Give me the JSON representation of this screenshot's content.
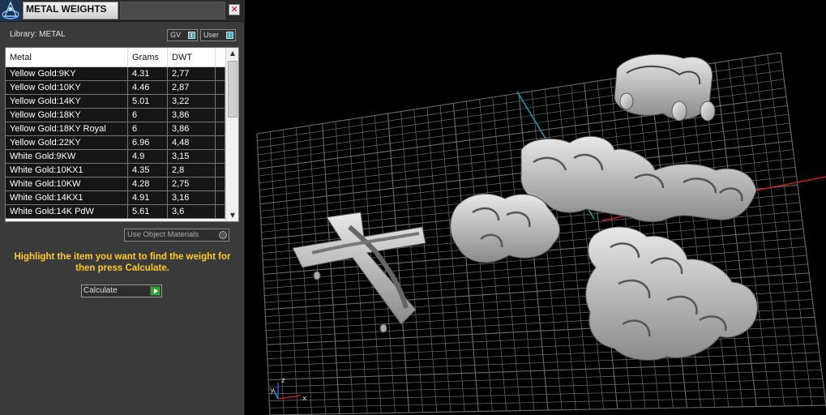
{
  "panel": {
    "title": "METAL WEIGHTS",
    "close_glyph": "✕",
    "library_label": "Library: METAL",
    "library_buttons": [
      {
        "label": "GV"
      },
      {
        "label": "User"
      }
    ]
  },
  "table": {
    "columns": [
      "Metal",
      "Grams",
      "DWT"
    ],
    "rows": [
      {
        "metal": "Yellow Gold:9KY",
        "grams": "4.31",
        "dwt": "2,77"
      },
      {
        "metal": "Yellow Gold:10KY",
        "grams": "4.46",
        "dwt": "2,87"
      },
      {
        "metal": "Yellow Gold:14KY",
        "grams": "5.01",
        "dwt": "3,22"
      },
      {
        "metal": "Yellow Gold:18KY",
        "grams": "6",
        "dwt": "3,86"
      },
      {
        "metal": "Yellow Gold:18KY Royal",
        "grams": "6",
        "dwt": "3,86"
      },
      {
        "metal": "Yellow Gold:22KY",
        "grams": "6.96",
        "dwt": "4,48"
      },
      {
        "metal": "White Gold:9KW",
        "grams": "4.9",
        "dwt": "3,15"
      },
      {
        "metal": "White Gold:10KX1",
        "grams": "4.35",
        "dwt": "2,8"
      },
      {
        "metal": "White Gold:10KW",
        "grams": "4.28",
        "dwt": "2,75"
      },
      {
        "metal": "White Gold:14KX1",
        "grams": "4.91",
        "dwt": "3,16"
      },
      {
        "metal": "White Gold:14K PdW",
        "grams": "5.61",
        "dwt": "3,6"
      }
    ]
  },
  "use_object_materials_label": "Use Object Materials",
  "hint_text": "Highlight the item you want to find the weight for then press Calculate.",
  "calculate_label": "Calculate",
  "viewport": {
    "axis_labels": {
      "z": "z",
      "y": "y",
      "x": "x"
    },
    "colors": {
      "grid": "#6e6e6e",
      "x_axis": "#c0201c",
      "y_axis": "#1aa0b0",
      "model": "#b8b8b8"
    }
  },
  "icons": {
    "app_logo": "app-logo-icon",
    "close": "close-icon",
    "scroll_up": "scroll-up-icon",
    "scroll_down": "scroll-down-icon",
    "calculate_go": "play-icon"
  }
}
